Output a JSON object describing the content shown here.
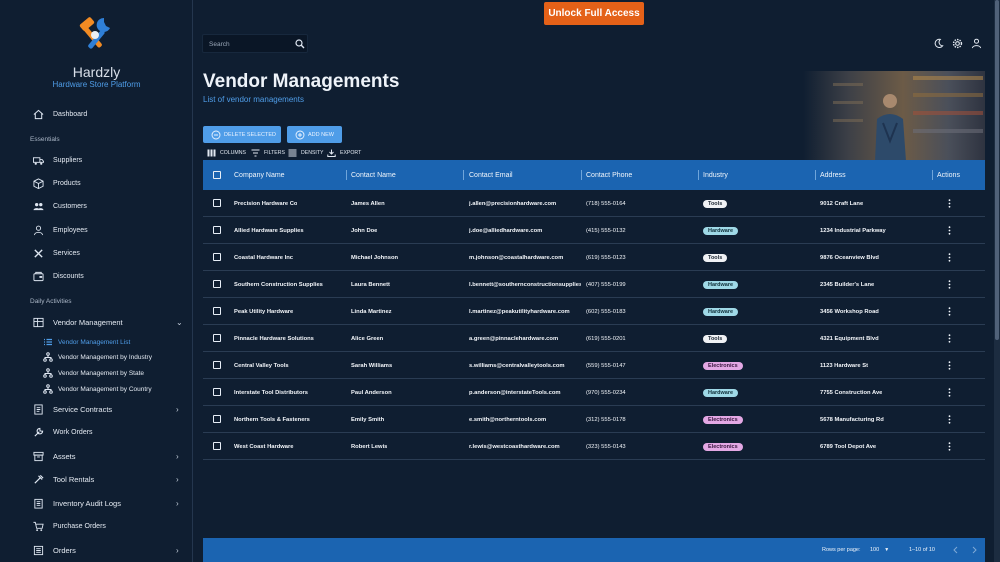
{
  "brand": {
    "name": "Hardzly",
    "subtitle": "Hardware Store Platform"
  },
  "sidebar": {
    "top_items": [
      {
        "label": "Dashboard",
        "icon": "home-icon"
      }
    ],
    "sections": {
      "essentials": "Essentials",
      "daily": "Daily Activities"
    },
    "essentials_items": [
      {
        "label": "Suppliers",
        "icon": "truck-icon"
      },
      {
        "label": "Products",
        "icon": "box-icon"
      },
      {
        "label": "Customers",
        "icon": "people-icon"
      },
      {
        "label": "Employees",
        "icon": "person-icon"
      },
      {
        "label": "Services",
        "icon": "tools-icon"
      },
      {
        "label": "Discounts",
        "icon": "wallet-icon"
      }
    ],
    "vendor_management": {
      "label": "Vendor Management",
      "icon": "grid-icon"
    },
    "vendor_sub": [
      {
        "label": "Vendor Management List",
        "icon": "list-icon",
        "active": true
      },
      {
        "label": "Vendor Management by Industry",
        "icon": "network-icon"
      },
      {
        "label": "Vendor Management by State",
        "icon": "network-icon"
      },
      {
        "label": "Vendor Management by Country",
        "icon": "network-icon"
      }
    ],
    "daily_items": [
      {
        "label": "Service Contracts",
        "icon": "document-icon",
        "chevron": true
      },
      {
        "label": "Work Orders",
        "icon": "wrench-icon",
        "chevron": false
      },
      {
        "label": "Assets",
        "icon": "archive-icon",
        "chevron": true
      },
      {
        "label": "Tool Rentals",
        "icon": "hammer-icon",
        "chevron": true
      },
      {
        "label": "Inventory Audit Logs",
        "icon": "clipboard-icon",
        "chevron": true
      },
      {
        "label": "Purchase Orders",
        "icon": "cart-icon",
        "chevron": false
      },
      {
        "label": "Orders",
        "icon": "receipt-icon",
        "chevron": true
      }
    ]
  },
  "topbar": {
    "search_placeholder": "Search",
    "unlock_label": "Unlock Full Access"
  },
  "header": {
    "title": "Vendor Managements",
    "breadcrumb": "List of vendor managements"
  },
  "actions": {
    "delete_label": "DELETE SELECTED",
    "add_label": "ADD NEW"
  },
  "toolbar": {
    "columns": "COLUMNS",
    "filters": "FILTERS",
    "density": "DENSITY",
    "export": "EXPORT"
  },
  "table": {
    "columns": [
      "Company Name",
      "Contact Name",
      "Contact Email",
      "Contact Phone",
      "Industry",
      "Address",
      "Actions"
    ],
    "rows": [
      {
        "company": "Precision Hardware Co",
        "contact": "James Allen",
        "email": "j.allen@precisionhardware.com",
        "phone": "(718) 555-0164",
        "industry": "Tools",
        "address": "9012 Craft Lane"
      },
      {
        "company": "Allied Hardware Supplies",
        "contact": "John Doe",
        "email": "j.doe@alliedhardware.com",
        "phone": "(415) 555-0132",
        "industry": "Hardware",
        "address": "1234 Industrial Parkway"
      },
      {
        "company": "Coastal Hardware Inc",
        "contact": "Michael Johnson",
        "email": "m.johnson@coastalhardware.com",
        "phone": "(619) 555-0123",
        "industry": "Tools",
        "address": "9876 Oceanview Blvd"
      },
      {
        "company": "Southern Construction Supplies",
        "contact": "Laura Bennett",
        "email": "l.bennett@southernconstructionsupplies.",
        "phone": "(407) 555-0199",
        "industry": "Hardware",
        "address": "2345 Builder's Lane"
      },
      {
        "company": "Peak Utility Hardware",
        "contact": "Linda Martinez",
        "email": "l.martinez@peakutilityhardware.com",
        "phone": "(602) 555-0183",
        "industry": "Hardware",
        "address": "3456 Workshop Road"
      },
      {
        "company": "Pinnacle Hardware Solutions",
        "contact": "Alice Green",
        "email": "a.green@pinnaclehardware.com",
        "phone": "(619) 555-0201",
        "industry": "Tools",
        "address": "4321 Equipment Blvd"
      },
      {
        "company": "Central Valley Tools",
        "contact": "Sarah Williams",
        "email": "s.williams@centralvalleytools.com",
        "phone": "(559) 555-0147",
        "industry": "Electronics",
        "address": "1123 Hardware St"
      },
      {
        "company": "Interstate Tool Distributors",
        "contact": "Paul Anderson",
        "email": "p.anderson@interstateTools.com",
        "phone": "(970) 555-0234",
        "industry": "Hardware",
        "address": "7755 Construction Ave"
      },
      {
        "company": "Northern Tools & Fasteners",
        "contact": "Emily Smith",
        "email": "e.smith@northerntools.com",
        "phone": "(312) 555-0178",
        "industry": "Electronics",
        "address": "5678 Manufacturing Rd"
      },
      {
        "company": "West Coast Hardware",
        "contact": "Robert Lewis",
        "email": "r.lewis@westcoasthardware.com",
        "phone": "(323) 555-0143",
        "industry": "Electronics",
        "address": "6789 Tool Depot Ave"
      }
    ]
  },
  "pagination": {
    "rows_per_page_label": "Rows per page:",
    "rows_per_page": "100",
    "range": "1–10 of 10"
  },
  "colors": {
    "accent": "#4f9de8",
    "header_bar": "#1b64b1",
    "unlock": "#e46118",
    "background": "#0f1e31"
  }
}
